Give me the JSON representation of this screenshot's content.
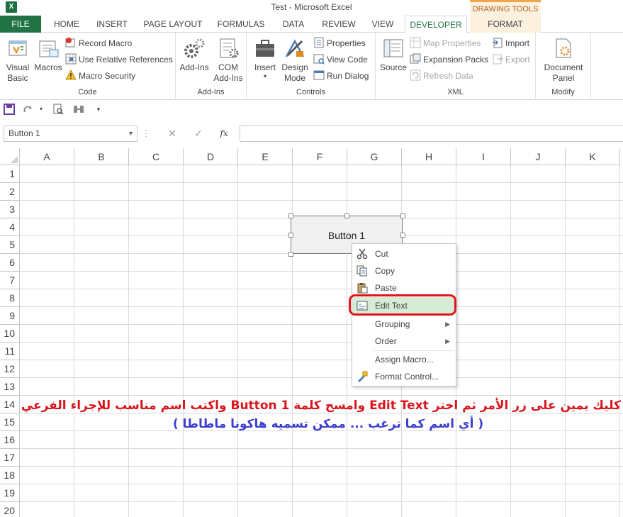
{
  "window": {
    "title": "Test - Microsoft Excel",
    "app_icon_glyph": "X",
    "contextual_tab_group": "DRAWING TOOLS"
  },
  "tabs": [
    "FILE",
    "HOME",
    "INSERT",
    "PAGE LAYOUT",
    "FORMULAS",
    "DATA",
    "REVIEW",
    "VIEW",
    "DEVELOPER",
    "FORMAT"
  ],
  "active_tab": "DEVELOPER",
  "ribbon": {
    "code": {
      "label": "Code",
      "visual_basic": "Visual\nBasic",
      "macros": "Macros",
      "record_macro": "Record Macro",
      "use_relative_references": "Use Relative References",
      "macro_security": "Macro Security"
    },
    "addins": {
      "label": "Add-Ins",
      "add_ins": "Add-Ins",
      "com_add_ins": "COM\nAdd-Ins"
    },
    "controls": {
      "label": "Controls",
      "insert": "Insert",
      "design_mode": "Design\nMode",
      "properties": "Properties",
      "view_code": "View Code",
      "run_dialog": "Run Dialog"
    },
    "xml": {
      "label": "XML",
      "source": "Source",
      "map_properties": "Map Properties",
      "expansion_packs": "Expansion Packs",
      "refresh_data": "Refresh Data",
      "import": "Import",
      "export": "Export"
    },
    "modify": {
      "label": "Modify",
      "document_panel": "Document\nPanel"
    }
  },
  "formula_bar": {
    "name_box": "Button 1",
    "fx": "fx",
    "formula": ""
  },
  "grid": {
    "columns": [
      "A",
      "B",
      "C",
      "D",
      "E",
      "F",
      "G",
      "H",
      "I",
      "J",
      "K"
    ],
    "rows": [
      "1",
      "2",
      "3",
      "4",
      "5",
      "6",
      "7",
      "8",
      "9",
      "10",
      "11",
      "12",
      "13",
      "14",
      "15",
      "16",
      "17",
      "18",
      "19",
      "20"
    ]
  },
  "shape": {
    "label": "Button 1"
  },
  "context_menu": {
    "items": [
      "Cut",
      "Copy",
      "Paste",
      "Edit Text",
      "Grouping",
      "Order",
      "Assign Macro...",
      "Format Control..."
    ],
    "highlighted": "Edit Text"
  },
  "annotation": {
    "line1": "كليك يمين على زر الأمر ثم اختر Edit Text وامسح كلمة Button 1 واكتب اسم مناسب للإجراء الفرعي",
    "line2": "( أي اسم كما ترغب ... ممكن تسميه هاكونا ماطاطا )"
  },
  "colors": {
    "excel_green": "#217346",
    "ring_red": "#e0141c",
    "annot_red": "#d9141b",
    "annot_blue": "#3c3fd0",
    "highlight": "#d7ecd6"
  }
}
